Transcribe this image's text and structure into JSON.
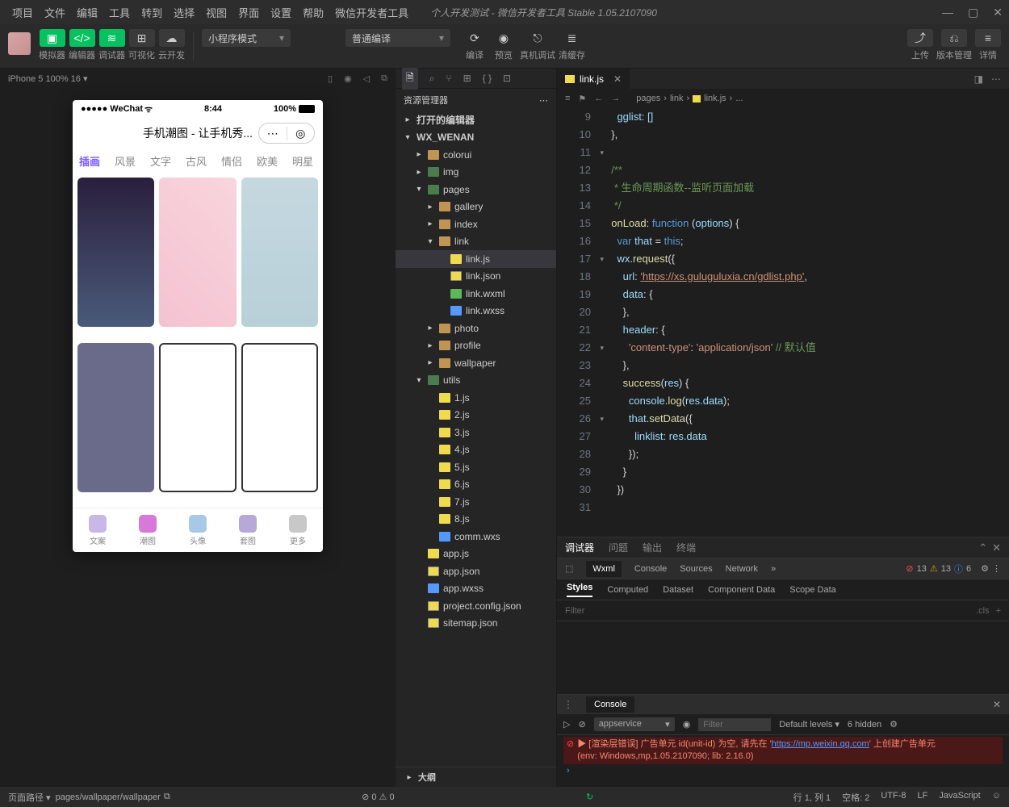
{
  "menu": [
    "项目",
    "文件",
    "编辑",
    "工具",
    "转到",
    "选择",
    "视图",
    "界面",
    "设置",
    "帮助",
    "微信开发者工具"
  ],
  "window_title": "个人开发测试 - 微信开发者工具 Stable 1.05.2107090",
  "toolbar": {
    "sim": "模拟器",
    "editor": "编辑器",
    "debugger": "调试器",
    "visual": "可视化",
    "cloud": "云开发",
    "mode": "小程序模式",
    "compile_mode": "普通编译",
    "compile": "编译",
    "preview": "预览",
    "remote": "真机调试",
    "clear": "清缓存",
    "upload": "上传",
    "version": "版本管理",
    "detail": "详情"
  },
  "sim_info": "iPhone 5 100% 16 ▾",
  "phone": {
    "carrier": "●●●●● WeChat",
    "wifi": "ᯤ",
    "time": "8:44",
    "battery": "100%",
    "title": "手机潮图 - 让手机秀...",
    "tabs": [
      "插画",
      "风景",
      "文字",
      "古风",
      "情侣",
      "欧美",
      "明星"
    ],
    "bottom": [
      "文案",
      "潮图",
      "头像",
      "套图",
      "更多"
    ]
  },
  "explorer": {
    "title": "资源管理器",
    "opened": "打开的编辑器",
    "project": "WX_WENAN",
    "outline": "大纲",
    "tree": [
      {
        "l": 1,
        "t": "folder",
        "n": "colorui",
        "c": false
      },
      {
        "l": 1,
        "t": "folder-g",
        "n": "img",
        "c": false
      },
      {
        "l": 1,
        "t": "folder-g",
        "n": "pages",
        "c": true,
        "open": true
      },
      {
        "l": 2,
        "t": "folder",
        "n": "gallery",
        "c": false
      },
      {
        "l": 2,
        "t": "folder",
        "n": "index",
        "c": false
      },
      {
        "l": 2,
        "t": "folder",
        "n": "link",
        "c": true,
        "open": true
      },
      {
        "l": 3,
        "t": "js",
        "n": "link.js",
        "sel": true
      },
      {
        "l": 3,
        "t": "json",
        "n": "link.json"
      },
      {
        "l": 3,
        "t": "wxml",
        "n": "link.wxml"
      },
      {
        "l": 3,
        "t": "wxss",
        "n": "link.wxss"
      },
      {
        "l": 2,
        "t": "folder",
        "n": "photo",
        "c": false
      },
      {
        "l": 2,
        "t": "folder",
        "n": "profile",
        "c": false
      },
      {
        "l": 2,
        "t": "folder",
        "n": "wallpaper",
        "c": false
      },
      {
        "l": 1,
        "t": "folder-g",
        "n": "utils",
        "c": true,
        "open": true
      },
      {
        "l": 2,
        "t": "js",
        "n": "1.js"
      },
      {
        "l": 2,
        "t": "js",
        "n": "2.js"
      },
      {
        "l": 2,
        "t": "js",
        "n": "3.js"
      },
      {
        "l": 2,
        "t": "js",
        "n": "4.js"
      },
      {
        "l": 2,
        "t": "js",
        "n": "5.js"
      },
      {
        "l": 2,
        "t": "js",
        "n": "6.js"
      },
      {
        "l": 2,
        "t": "js",
        "n": "7.js"
      },
      {
        "l": 2,
        "t": "js",
        "n": "8.js"
      },
      {
        "l": 2,
        "t": "wxss",
        "n": "comm.wxs"
      },
      {
        "l": 1,
        "t": "js",
        "n": "app.js"
      },
      {
        "l": 1,
        "t": "json",
        "n": "app.json"
      },
      {
        "l": 1,
        "t": "wxss",
        "n": "app.wxss"
      },
      {
        "l": 1,
        "t": "json",
        "n": "project.config.json"
      },
      {
        "l": 1,
        "t": "json",
        "n": "sitemap.json"
      }
    ]
  },
  "tab_file": "link.js",
  "breadcrumb": [
    "pages",
    "link",
    "link.js",
    "..."
  ],
  "code": {
    "line9": "gglist: []",
    "comment1": "/**",
    "comment2": " * 生命周期函数--监听页面加载",
    "comment3": " */",
    "onload": "onLoad",
    "function": "function",
    "options": "options",
    "var": "var",
    "that": "that",
    "this": "this",
    "wx": "wx",
    "request": "request",
    "url_lbl": "url",
    "url": "'https://xs.guluguluxia.cn/gdlist.php'",
    "data_lbl": "data",
    "header_lbl": "header",
    "ct": "'content-type'",
    "appjson": "'application/json'",
    "def": "// 默认值",
    "success": "success",
    "res": "res",
    "console": "console",
    "log": "log",
    "resdata": "res.data",
    "setData": "setData",
    "linklist": "linklist"
  },
  "debugger": {
    "tabs": [
      "调试器",
      "问题",
      "输出",
      "终端"
    ],
    "tools": [
      "Wxml",
      "Console",
      "Sources",
      "Network"
    ],
    "err": "13",
    "warn": "13",
    "info": "6",
    "subtabs": [
      "Styles",
      "Computed",
      "Dataset",
      "Component Data",
      "Scope Data"
    ],
    "filter": "Filter",
    "cls": ".cls"
  },
  "console": {
    "tab": "Console",
    "context": "appservice",
    "filter_ph": "Filter",
    "levels": "Default levels ▾",
    "hidden": "6 hidden",
    "err_prefix": "▶ [渲染层错误] 广告单元 id(unit-id) 为空, 请先在 '",
    "err_link": "https://mp.weixin.qq.com",
    "err_suffix": "' 上创建广告单元",
    "err_env": "(env: Windows,mp,1.05.2107090; lib: 2.16.0)"
  },
  "status": {
    "path_lbl": "页面路径 ▾",
    "path": "pages/wallpaper/wallpaper",
    "issues": "⊘ 0 ⚠ 0",
    "pos": "行 1, 列 1",
    "space": "空格: 2",
    "enc": "UTF-8",
    "eol": "LF",
    "lang": "JavaScript"
  }
}
